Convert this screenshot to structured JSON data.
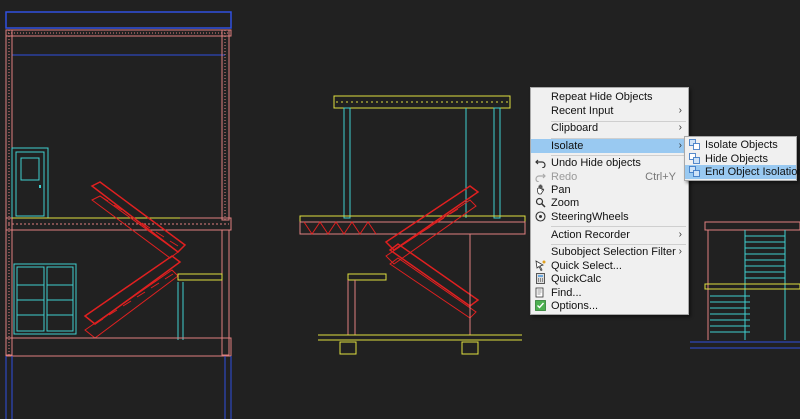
{
  "context_menu": {
    "items": [
      {
        "label": "Repeat Hide Objects",
        "icon": "none"
      },
      {
        "label": "Recent Input",
        "submenu": true,
        "icon": "none"
      },
      {
        "label": "Clipboard",
        "submenu": true,
        "icon": "none"
      },
      {
        "label": "Isolate",
        "submenu": true,
        "highlighted": true,
        "icon": "none"
      },
      {
        "label": "Undo Hide objects",
        "icon": "undo-icon"
      },
      {
        "label": "Redo",
        "shortcut": "Ctrl+Y",
        "disabled": true,
        "icon": "redo-icon"
      },
      {
        "label": "Pan",
        "icon": "pan-icon"
      },
      {
        "label": "Zoom",
        "icon": "zoom-icon"
      },
      {
        "label": "SteeringWheels",
        "icon": "steering-wheel-icon"
      },
      {
        "label": "Action Recorder",
        "submenu": true,
        "icon": "none"
      },
      {
        "label": "Subobject Selection Filter",
        "submenu": true,
        "icon": "none"
      },
      {
        "label": "Quick Select...",
        "icon": "quick-select-icon"
      },
      {
        "label": "QuickCalc",
        "icon": "calculator-icon"
      },
      {
        "label": "Find...",
        "icon": "find-icon"
      },
      {
        "label": "Options...",
        "icon": "options-icon"
      }
    ]
  },
  "isolate_submenu": {
    "items": [
      {
        "label": "Isolate Objects",
        "icon": "isolate-objects-icon"
      },
      {
        "label": "Hide Objects",
        "icon": "hide-objects-icon"
      },
      {
        "label": "End Object Isolation",
        "highlighted": true,
        "icon": "end-isolation-icon"
      }
    ]
  },
  "colors": {
    "background": "#212121",
    "menu_background": "#f0f0f0",
    "highlight": "#99c9f1",
    "stair_red": "#e02020",
    "wall_pink": "#e08080",
    "cyan": "#40d0d0",
    "yellow": "#e0e040",
    "blue": "#3050e0"
  }
}
